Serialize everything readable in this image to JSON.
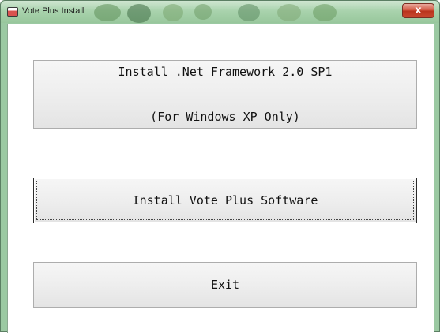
{
  "window": {
    "title": "Vote Plus Install",
    "close_label": "x"
  },
  "buttons": {
    "net_framework_line1": "Install .Net Framework 2.0 SP1",
    "net_framework_line2": "(For Windows XP Only)",
    "install_vote_plus": "Install Vote Plus Software",
    "exit": "Exit"
  }
}
